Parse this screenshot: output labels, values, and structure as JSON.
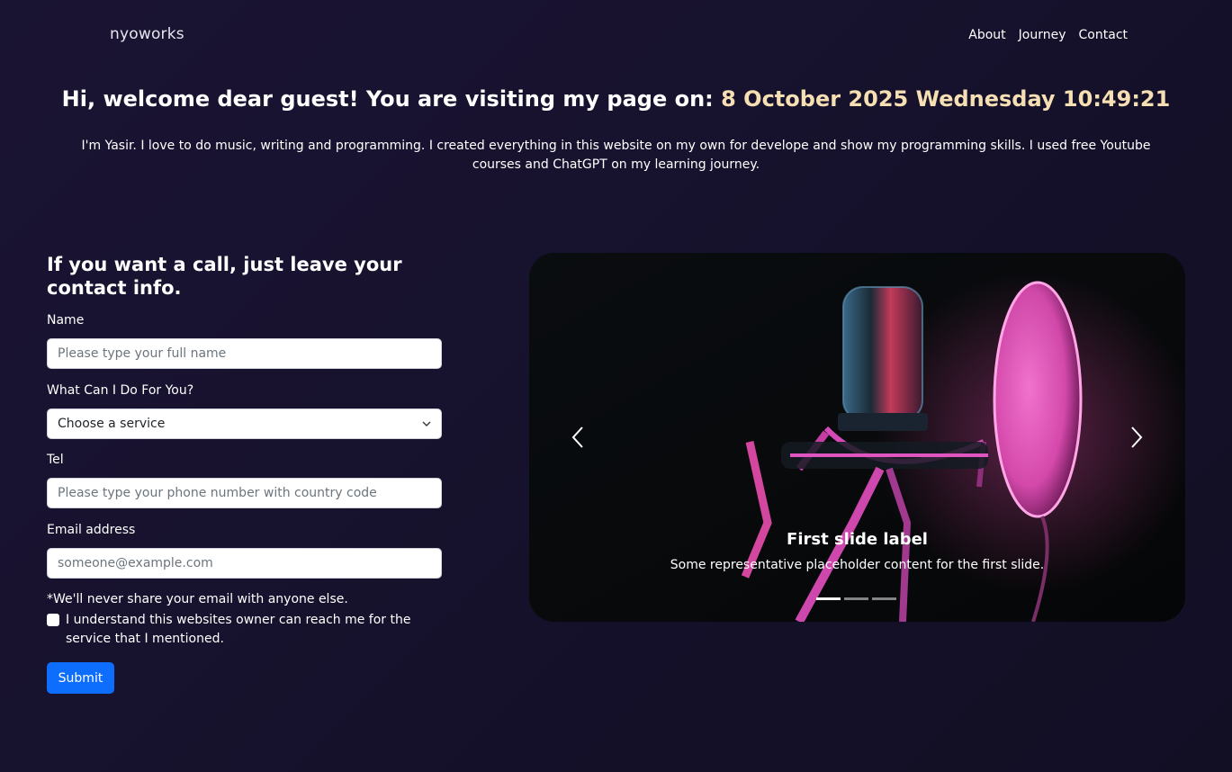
{
  "nav": {
    "brand": "nyoworks",
    "links": [
      "About",
      "Journey",
      "Contact"
    ]
  },
  "hero": {
    "welcome_prefix": "Hi, welcome dear guest! You are visiting my page on: ",
    "date_text": "8 October 2025 Wednesday 10:49:21",
    "intro": "I'm Yasir. I love to do music, writing and programming. I created everything in this website on my own for develope and show my programming skills. I used free Youtube courses and ChatGPT on my learning journey."
  },
  "form": {
    "heading": "If you want a call, just leave your contact info.",
    "name_label": "Name",
    "name_placeholder": "Please type your full name",
    "service_label": "What Can I Do For You?",
    "service_selected": "Choose a service",
    "tel_label": "Tel",
    "tel_placeholder": "Please type your phone number with country code",
    "email_label": "Email address",
    "email_placeholder": "someone@example.com",
    "privacy_note": "*We'll never share your email with anyone else.",
    "consent_text": "I understand this websites owner can reach me for the service that I mentioned.",
    "submit_label": "Submit"
  },
  "carousel": {
    "slide_title": "First slide label",
    "slide_text": "Some representative placeholder content for the first slide.",
    "active_index": 0,
    "indicator_count": 3
  },
  "colors": {
    "accent_date": "#f5dfb3",
    "submit_bg": "#0d6efd",
    "page_bg": "#17122e"
  },
  "icons": {
    "prev": "chevron-left-icon",
    "next": "chevron-right-icon",
    "select": "chevron-down-icon"
  }
}
